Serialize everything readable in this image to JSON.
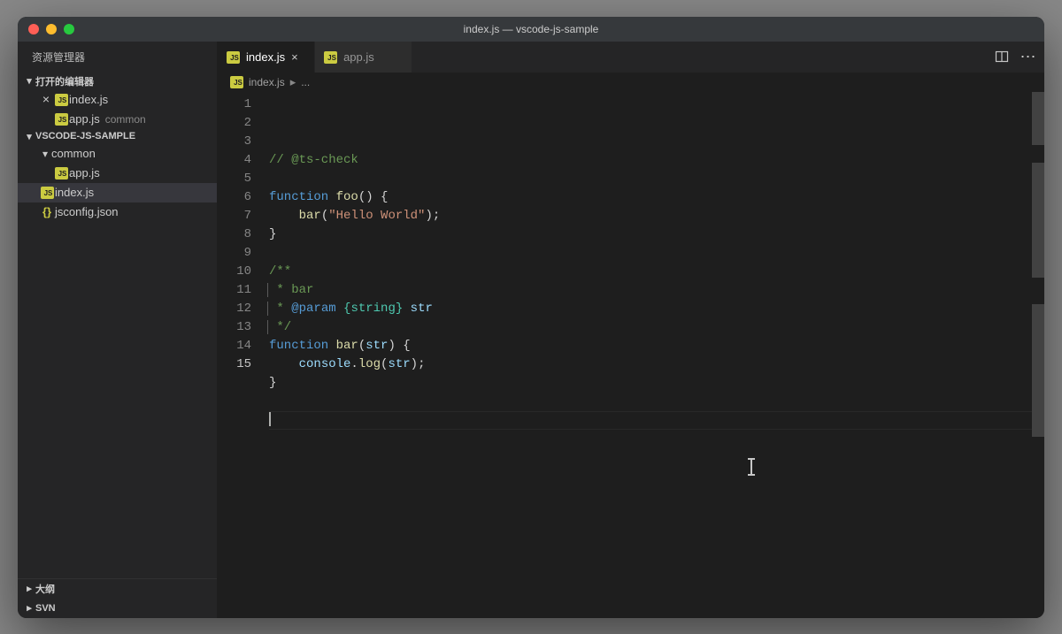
{
  "window": {
    "title": "index.js — vscode-js-sample"
  },
  "sidebar": {
    "title": "资源管理器",
    "open_editors_label": "打开的编辑器",
    "open_editors": [
      {
        "name": "index.js",
        "icon": "js",
        "closable": true
      },
      {
        "name": "app.js",
        "icon": "js",
        "closable": false,
        "hint": "common"
      }
    ],
    "workspace_label": "VSCODE-JS-SAMPLE",
    "tree": [
      {
        "type": "folder",
        "name": "common",
        "depth": 1,
        "expanded": true
      },
      {
        "type": "file",
        "name": "app.js",
        "icon": "js",
        "depth": 2
      },
      {
        "type": "file",
        "name": "index.js",
        "icon": "js",
        "depth": 1,
        "selected": true
      },
      {
        "type": "file",
        "name": "jsconfig.json",
        "icon": "json",
        "depth": 1
      }
    ],
    "outline_label": "大纲",
    "svn_label": "SVN"
  },
  "tabs": [
    {
      "name": "index.js",
      "icon": "js",
      "active": true
    },
    {
      "name": "app.js",
      "icon": "js",
      "active": false
    }
  ],
  "breadcrumb": {
    "file": "index.js",
    "tail": "..."
  },
  "code": {
    "lines": [
      {
        "n": 1,
        "tokens": [
          {
            "t": "// @ts-check",
            "c": "comment"
          }
        ]
      },
      {
        "n": 2,
        "tokens": []
      },
      {
        "n": 3,
        "tokens": [
          {
            "t": "function",
            "c": "keyword"
          },
          {
            "t": " "
          },
          {
            "t": "foo",
            "c": "func"
          },
          {
            "t": "() {",
            "c": "punc"
          }
        ]
      },
      {
        "n": 4,
        "tokens": [
          {
            "t": "    "
          },
          {
            "t": "bar",
            "c": "func"
          },
          {
            "t": "(",
            "c": "punc"
          },
          {
            "t": "\"Hello World\"",
            "c": "string"
          },
          {
            "t": ");",
            "c": "punc"
          }
        ]
      },
      {
        "n": 5,
        "tokens": [
          {
            "t": "}",
            "c": "punc"
          }
        ]
      },
      {
        "n": 6,
        "tokens": []
      },
      {
        "n": 7,
        "tokens": [
          {
            "t": "/**",
            "c": "comment"
          }
        ]
      },
      {
        "n": 8,
        "tokens": [
          {
            "t": " * bar",
            "c": "comment"
          }
        ],
        "docborder": true
      },
      {
        "n": 9,
        "tokens": [
          {
            "t": " * ",
            "c": "comment"
          },
          {
            "t": "@param",
            "c": "doctag"
          },
          {
            "t": " ",
            "c": "comment"
          },
          {
            "t": "{string}",
            "c": "type"
          },
          {
            "t": " ",
            "c": "comment"
          },
          {
            "t": "str",
            "c": "param"
          }
        ],
        "docborder": true
      },
      {
        "n": 10,
        "tokens": [
          {
            "t": " */",
            "c": "comment"
          }
        ],
        "docborder": true
      },
      {
        "n": 11,
        "tokens": [
          {
            "t": "function",
            "c": "keyword"
          },
          {
            "t": " "
          },
          {
            "t": "bar",
            "c": "func"
          },
          {
            "t": "(",
            "c": "punc"
          },
          {
            "t": "str",
            "c": "param"
          },
          {
            "t": ") {",
            "c": "punc"
          }
        ]
      },
      {
        "n": 12,
        "tokens": [
          {
            "t": "    "
          },
          {
            "t": "console",
            "c": "obj"
          },
          {
            "t": ".",
            "c": "punc"
          },
          {
            "t": "log",
            "c": "func"
          },
          {
            "t": "(",
            "c": "punc"
          },
          {
            "t": "str",
            "c": "param"
          },
          {
            "t": ");",
            "c": "punc"
          }
        ]
      },
      {
        "n": 13,
        "tokens": [
          {
            "t": "}",
            "c": "punc"
          }
        ]
      },
      {
        "n": 14,
        "tokens": []
      },
      {
        "n": 15,
        "tokens": [],
        "current": true,
        "cursor": true
      }
    ]
  },
  "icons": {
    "chevron_down": "▾",
    "chevron_right": "▸",
    "close": "×",
    "more": "⋯"
  }
}
